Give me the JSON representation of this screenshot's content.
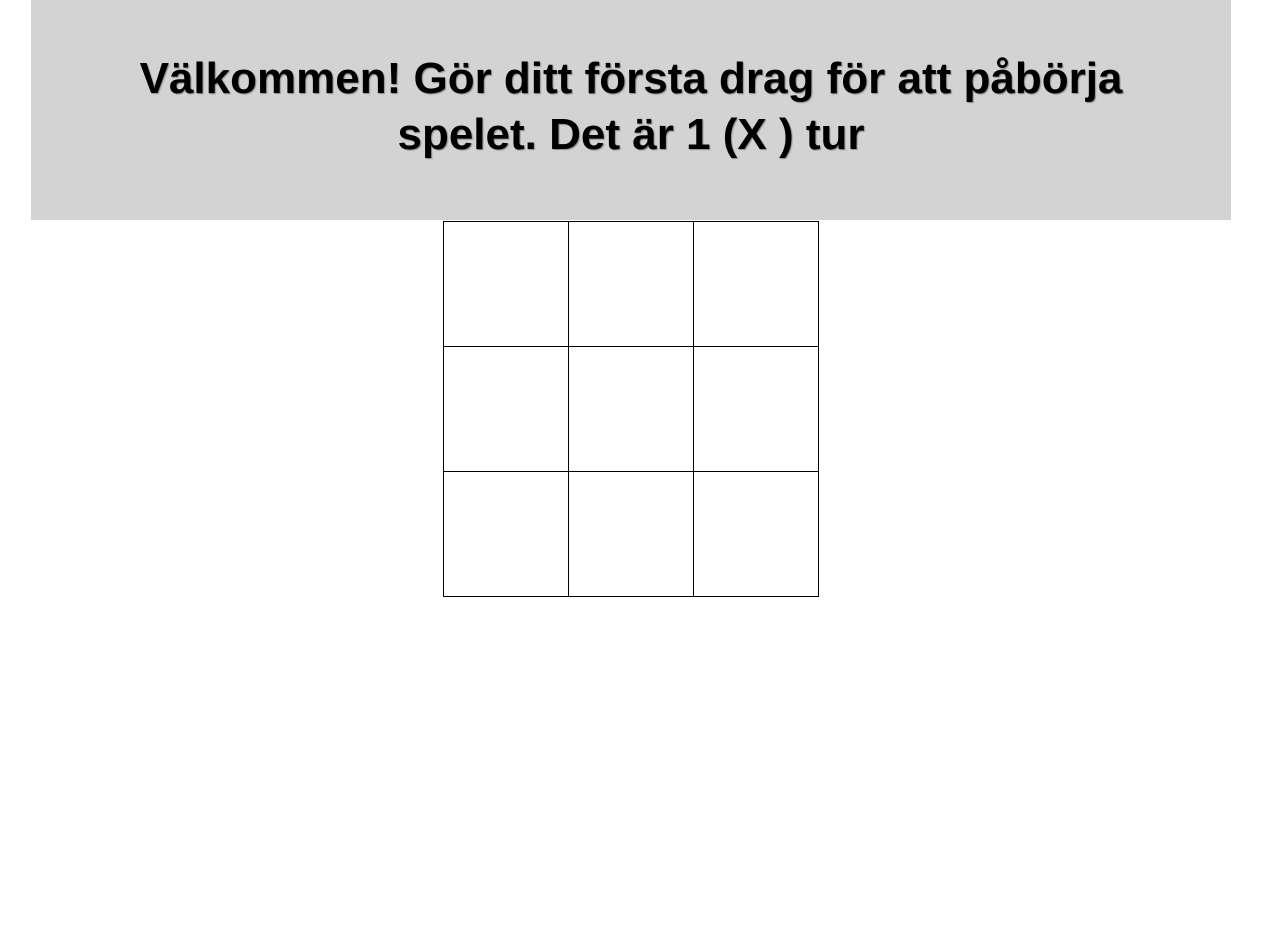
{
  "status": {
    "message": "Välkommen! Gör ditt första drag för att påbörja spelet. Det är 1 (X ) tur"
  },
  "board": {
    "cells": [
      "",
      "",
      "",
      "",
      "",
      "",
      "",
      "",
      ""
    ]
  },
  "colors": {
    "banner_background": "#d3d3d3",
    "grid_line": "#000000",
    "cell_background": "#ffffff"
  }
}
